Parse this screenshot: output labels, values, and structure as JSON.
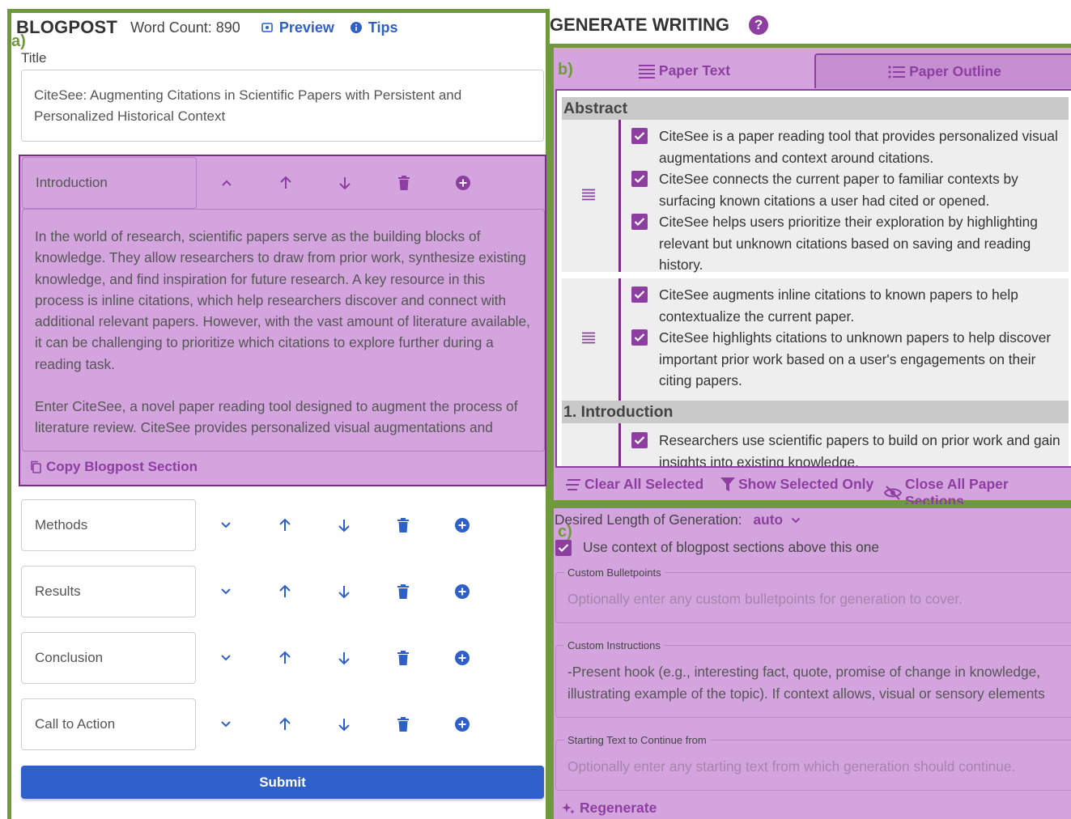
{
  "labels": {
    "a": "a)",
    "b": "b)",
    "c": "c)"
  },
  "blogpost": {
    "title": "BLOGPOST",
    "word_count": "Word Count: 890",
    "preview_label": "Preview",
    "tips_label": "Tips",
    "title_label": "Title",
    "title_value": "CiteSee: Augmenting Citations in Scientific Papers with Persistent and Personalized Historical Context",
    "expanded_section": {
      "name": "Introduction",
      "paragraphs": [
        "In the world of research, scientific papers serve as the building blocks of knowledge. They allow researchers to draw from prior work, synthesize existing knowledge, and find inspiration for future research. A key resource in this process is inline citations, which help researchers discover and connect with additional relevant papers. However, with the vast amount of literature available, it can be challenging to prioritize which citations to explore further during a reading task.",
        "Enter CiteSee, a novel paper reading tool designed to augment the process of literature review. CiteSee provides personalized visual augmentations and"
      ],
      "copy_label": "Copy Blogpost Section"
    },
    "sections": [
      "Methods",
      "Results",
      "Conclusion",
      "Call to Action"
    ],
    "submit_label": "Submit"
  },
  "generate": {
    "title": "GENERATE WRITING",
    "help": "?",
    "tabs": {
      "paper_text": "Paper Text",
      "paper_outline": "Paper Outline"
    },
    "outline": {
      "abstract_head": "Abstract",
      "abstract_groups": [
        [
          "CiteSee is a paper reading tool that provides personalized visual augmentations and context around citations.",
          "CiteSee connects the current paper to familiar contexts by surfacing known citations a user had cited or opened.",
          "CiteSee helps users prioritize their exploration by highlighting relevant but unknown citations based on saving and reading history."
        ],
        [
          "CiteSee augments inline citations to known papers to help contextualize the current paper.",
          "CiteSee highlights citations to unknown papers to help discover important prior work based on a user's engagements on their citing papers."
        ]
      ],
      "intro_head": "1. Introduction",
      "intro_items": [
        "Researchers use scientific papers to build on prior work and gain insights into existing knowledge."
      ]
    },
    "actions": {
      "clear": "Clear All Selected",
      "show_selected": "Show Selected Only",
      "close_sections": "Close All Paper Sections"
    },
    "length_label": "Desired Length of Generation:",
    "length_value": "auto",
    "context_label": "Use context of blogpost sections above this one",
    "custom_bullets": {
      "legend": "Custom Bulletpoints",
      "placeholder": "Optionally enter any custom bulletpoints for generation to cover."
    },
    "custom_instructions": {
      "legend": "Custom Instructions",
      "value": "-Present hook (e.g., interesting fact, quote, promise of change in knowledge, illustrating example of the topic). If context allows, visual or sensory elements"
    },
    "starting_text": {
      "legend": "Starting Text to Continue from",
      "placeholder": "Optionally enter any starting text from which generation should continue."
    },
    "regenerate_label": "Regenerate"
  },
  "colors": {
    "accent_blue": "#2f5fc9",
    "accent_purple": "#8d3ea0",
    "section_bg": "#d3a4dd",
    "frame_green": "#6f9a3c"
  }
}
